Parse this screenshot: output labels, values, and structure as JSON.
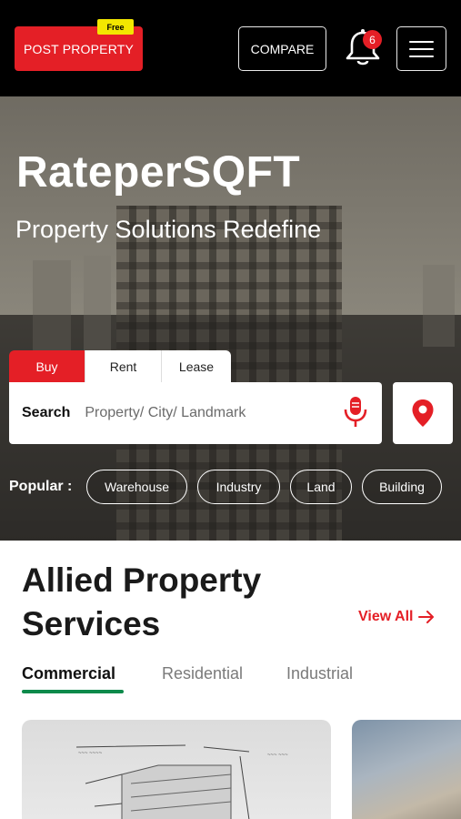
{
  "header": {
    "post_property_label": "POST PROPERTY",
    "free_badge": "Free",
    "compare_label": "COMPARE",
    "notification_count": "6",
    "menu_icon": "hamburger-icon",
    "bell_icon": "bell-icon"
  },
  "hero": {
    "title": "RateperSQFT",
    "subtitle": "Property Solutions Redefine",
    "tabs": [
      {
        "label": "Buy",
        "active": true
      },
      {
        "label": "Rent",
        "active": false
      },
      {
        "label": "Lease",
        "active": false
      }
    ],
    "search": {
      "label": "Search",
      "placeholder": "Property/ City/ Landmark",
      "value": ""
    },
    "popular_label": "Popular :",
    "popular_chips": [
      "Warehouse",
      "Industry",
      "Land",
      "Building"
    ]
  },
  "services": {
    "title": "Allied Property Services",
    "view_all_label": "View All",
    "tabs": [
      {
        "label": "Commercial",
        "active": true
      },
      {
        "label": "Residential",
        "active": false
      },
      {
        "label": "Industrial",
        "active": false
      }
    ]
  },
  "colors": {
    "accent_red": "#e41f26",
    "badge_yellow": "#f3e600",
    "active_tab_green": "#0c8a4b",
    "header_bg": "#000000"
  }
}
